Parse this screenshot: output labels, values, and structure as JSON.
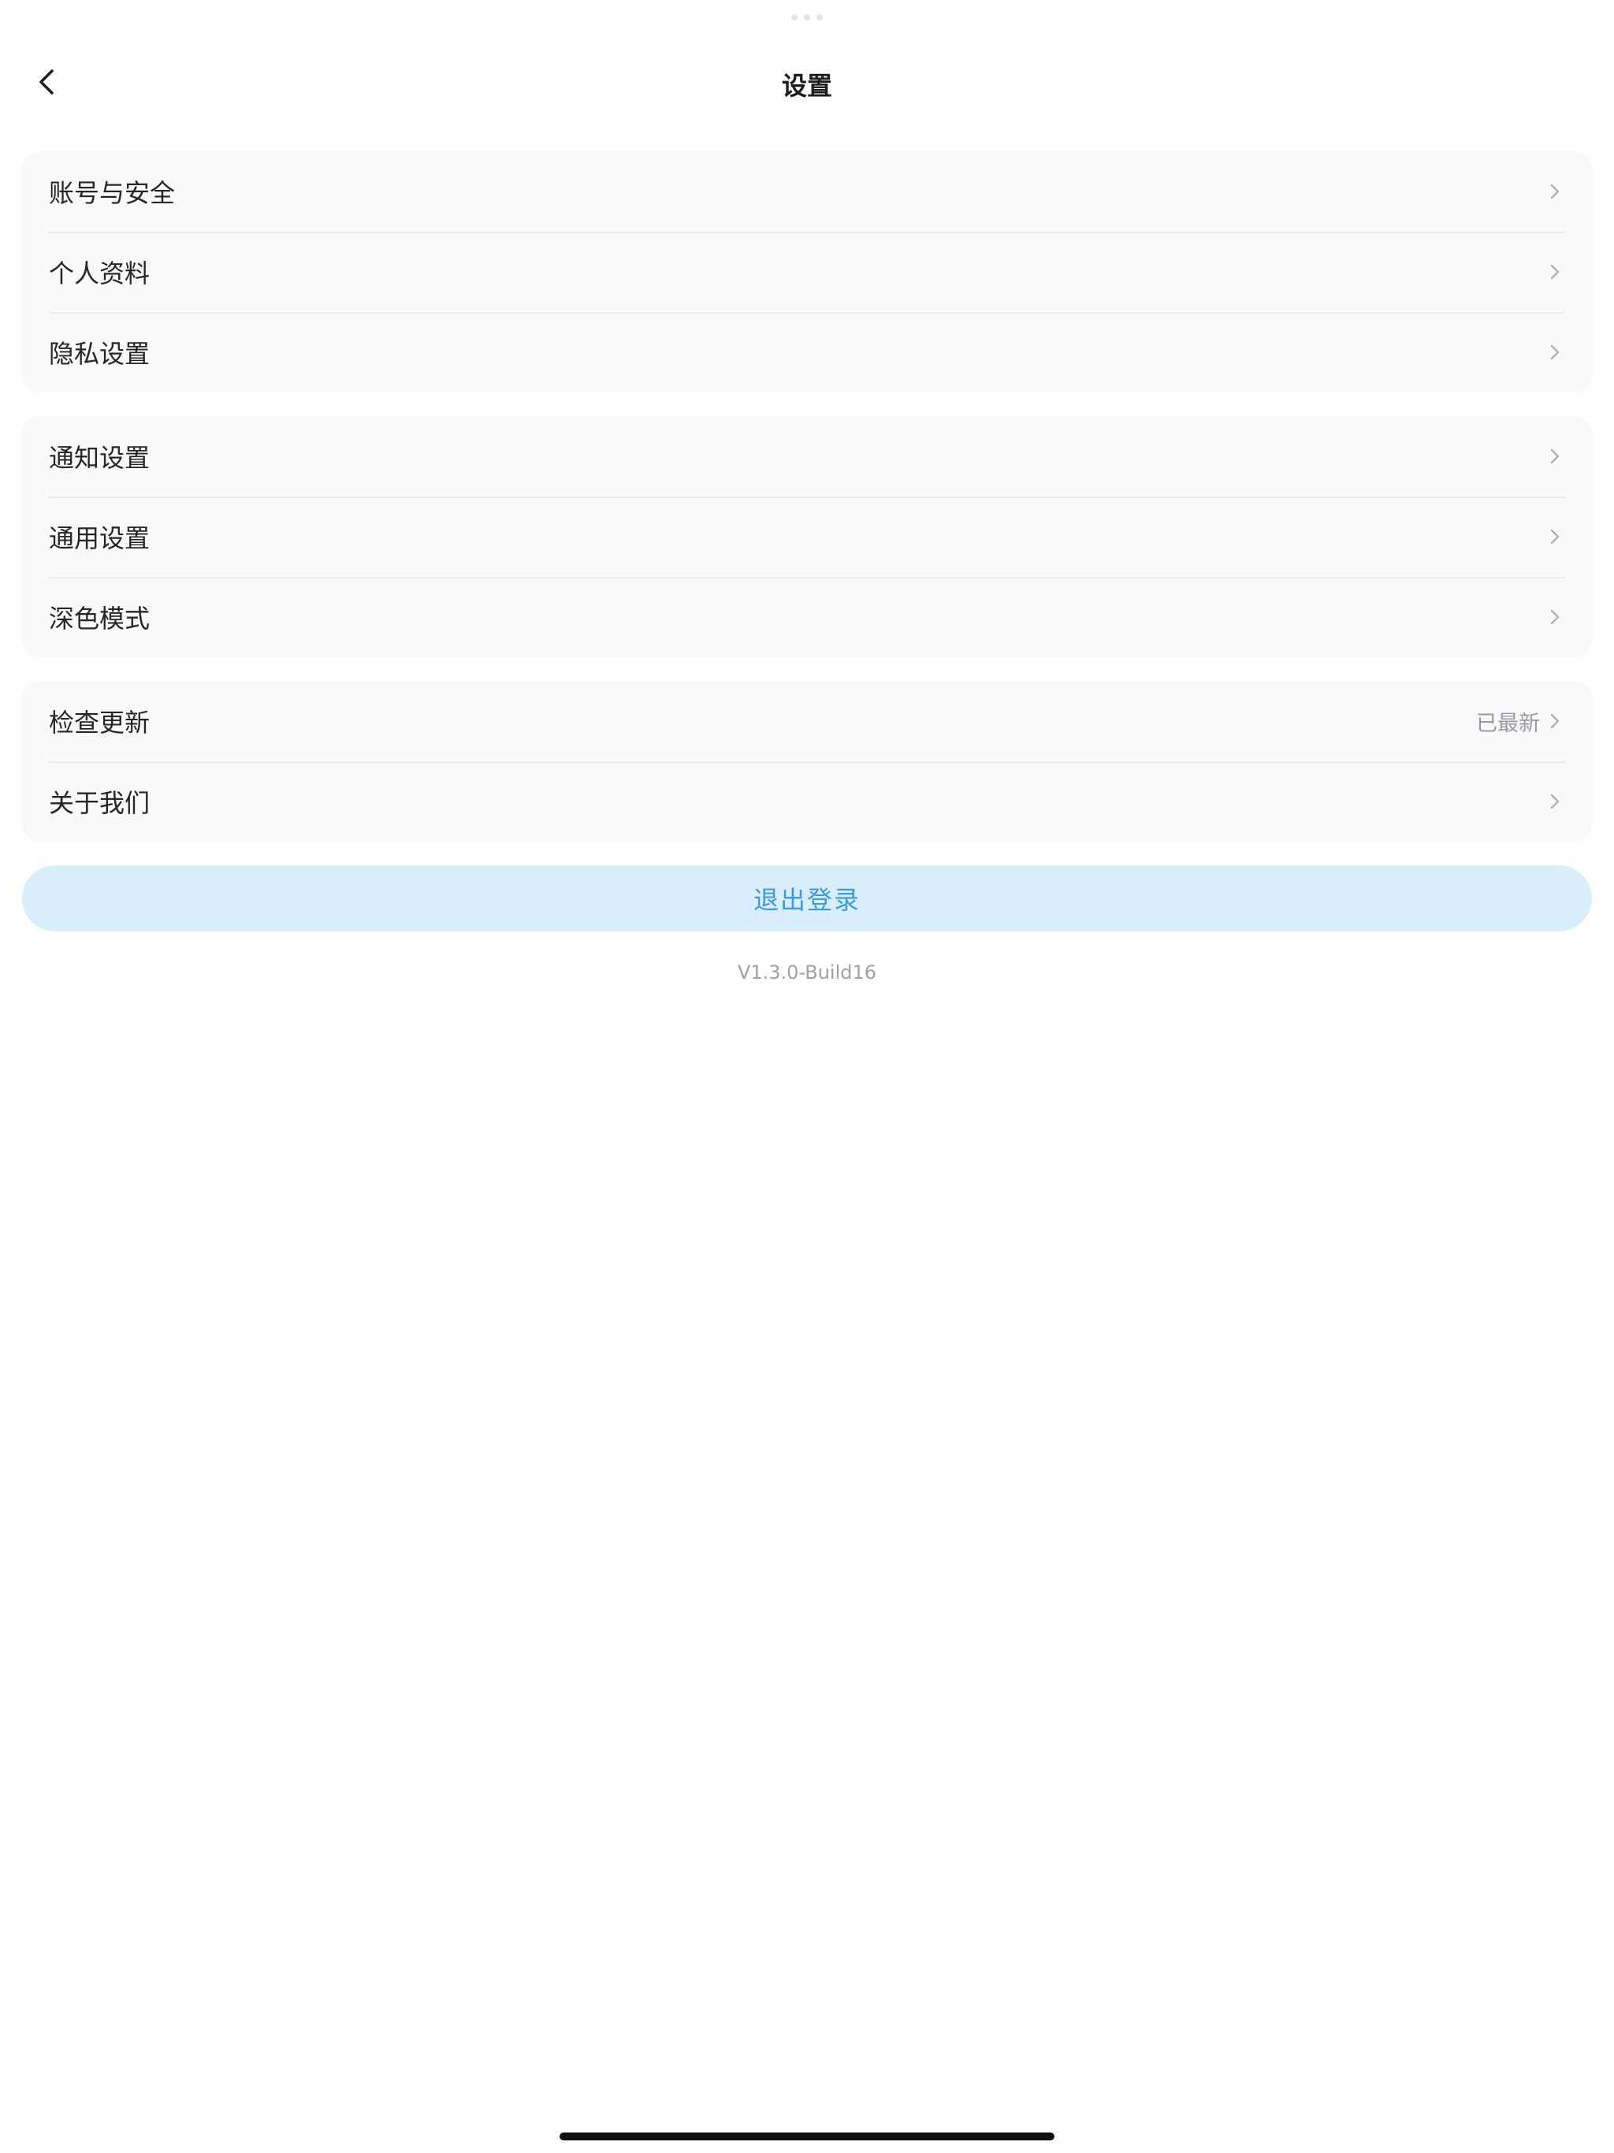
{
  "header": {
    "title": "设置",
    "back_icon": "chevron-left-icon"
  },
  "groups": [
    {
      "items": [
        {
          "label": "账号与安全"
        },
        {
          "label": "个人资料"
        },
        {
          "label": "隐私设置"
        }
      ]
    },
    {
      "items": [
        {
          "label": "通知设置"
        },
        {
          "label": "通用设置"
        },
        {
          "label": "深色模式"
        }
      ]
    },
    {
      "items": [
        {
          "label": "检查更新",
          "value": "已最新"
        },
        {
          "label": "关于我们"
        }
      ]
    }
  ],
  "logout": {
    "label": "退出登录"
  },
  "version": "V1.3.0-Build16",
  "colors": {
    "group_bg": "#f9f9fc",
    "divider": "#ebebef",
    "logout_bg": "#d9eefd",
    "logout_text": "#3a9be0",
    "muted_text": "#9a9a9f"
  }
}
